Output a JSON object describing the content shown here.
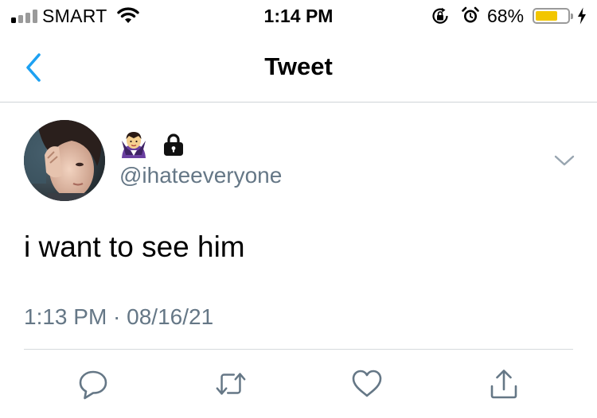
{
  "status_bar": {
    "carrier": "SMART",
    "time": "1:14 PM",
    "battery_percent": "68%",
    "battery_level": 0.68,
    "battery_color": "#f2c600",
    "icons": [
      "signal-icon",
      "wifi-icon",
      "rotation-lock-icon",
      "alarm-icon",
      "battery-icon",
      "charging-bolt-icon"
    ]
  },
  "nav": {
    "title": "Tweet",
    "back_icon": "chevron-left-icon",
    "accent_color": "#1da1f2"
  },
  "tweet": {
    "name_emoji": "vampire-emoji",
    "protected_icon": "lock-icon",
    "handle": "@ihateeveryone",
    "text": "i want to see him",
    "timestamp": "1:13 PM · 08/16/21",
    "menu_icon": "chevron-down-icon",
    "secondary_color": "#657786"
  },
  "actions": [
    {
      "name": "reply",
      "icon": "reply-icon"
    },
    {
      "name": "retweet",
      "icon": "retweet-icon"
    },
    {
      "name": "like",
      "icon": "heart-icon"
    },
    {
      "name": "share",
      "icon": "share-icon"
    }
  ]
}
